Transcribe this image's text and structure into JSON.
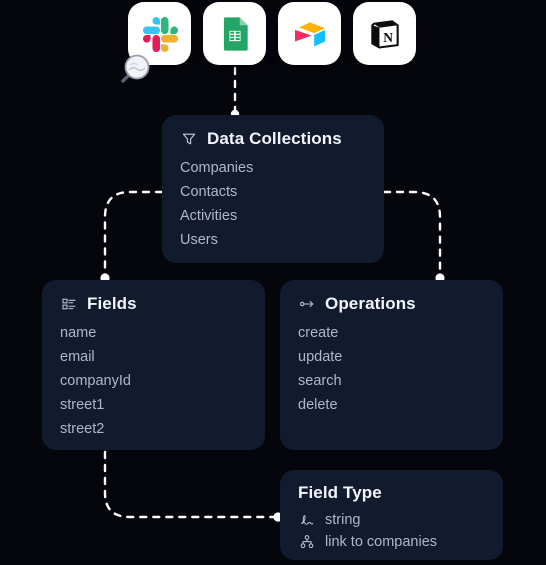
{
  "canvas": {
    "background_color": "#05060c",
    "card_color": "#121a2e",
    "connector_color": "#ffffff",
    "title_color": "#f2f5fb",
    "item_color": "#aeb7cd"
  },
  "app_icons": [
    {
      "name": "slack-icon",
      "label": "Slack"
    },
    {
      "name": "google-sheets-icon",
      "label": "Google Sheets"
    },
    {
      "name": "airtable-icon",
      "label": "Airtable"
    },
    {
      "name": "notion-icon",
      "label": "Notion"
    }
  ],
  "cursor": {
    "name": "magnifier-cursor",
    "label": "Magnifier"
  },
  "cards": {
    "collections": {
      "title": "Data Collections",
      "icon": "filter-icon",
      "items": [
        "Companies",
        "Contacts",
        "Activities",
        "Users"
      ]
    },
    "fields": {
      "title": "Fields",
      "icon": "list-icon",
      "items": [
        "name",
        "email",
        "companyId",
        "street1",
        "street2"
      ]
    },
    "operations": {
      "title": "Operations",
      "icon": "arrow-link-icon",
      "items": [
        "create",
        "update",
        "search",
        "delete"
      ]
    },
    "field_type": {
      "title": "Field Type",
      "items": [
        {
          "icon": "signature-icon",
          "label": "string"
        },
        {
          "icon": "hierarchy-icon",
          "label": "link to companies"
        }
      ]
    }
  }
}
